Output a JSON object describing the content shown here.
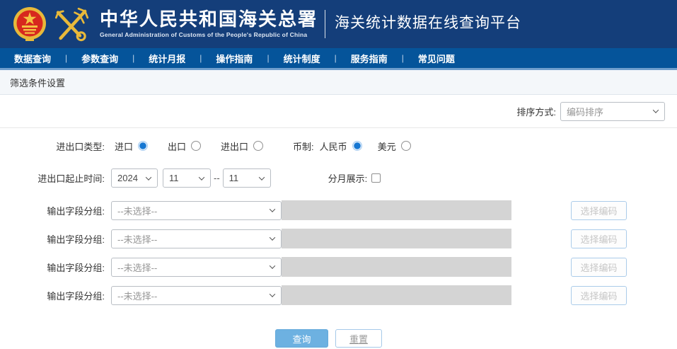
{
  "header": {
    "agency_title_cn": "中华人民共和国海关总署",
    "agency_title_en": "General Administration of Customs of the People's Republic of China",
    "platform_title": "海关统计数据在线查询平台"
  },
  "nav": {
    "separator": "|",
    "items": [
      "数据查询",
      "参数查询",
      "统计月报",
      "操作指南",
      "统计制度",
      "服务指南",
      "常见问题"
    ]
  },
  "section_title": "筛选条件设置",
  "sort": {
    "label": "排序方式:",
    "value": "编码排序"
  },
  "form": {
    "trade_type": {
      "label": "进出口类型:",
      "options": [
        {
          "label": "进口",
          "selected": true
        },
        {
          "label": "出口",
          "selected": false
        },
        {
          "label": "进出口",
          "selected": false
        }
      ]
    },
    "currency": {
      "label": "币制:",
      "options": [
        {
          "label": "人民币",
          "selected": true
        },
        {
          "label": "美元",
          "selected": false
        }
      ]
    },
    "time": {
      "label": "进出口起止时间:",
      "year": "2024",
      "month_from": "11",
      "dash": "--",
      "month_to": "11"
    },
    "monthly": {
      "label": "分月展示:",
      "checked": false
    },
    "output_groups": [
      {
        "label": "输出字段分组:",
        "value": "--未选择--",
        "input_value": "",
        "button": "选择编码"
      },
      {
        "label": "输出字段分组:",
        "value": "--未选择--",
        "input_value": "",
        "button": "选择编码"
      },
      {
        "label": "输出字段分组:",
        "value": "--未选择--",
        "input_value": "",
        "button": "选择编码"
      },
      {
        "label": "输出字段分组:",
        "value": "--未选择--",
        "input_value": "",
        "button": "选择编码"
      }
    ]
  },
  "actions": {
    "query": "查询",
    "reset": "重置"
  },
  "colors": {
    "header_bg": "#143E7A",
    "nav_bg": "#05549A",
    "nav_stripe": "#6F9ECD",
    "accent_blue": "#6DB1E1",
    "emblem_red": "#D7281E",
    "gold": "#E8B93A",
    "disabled_input_bg": "#D4D4D4"
  }
}
